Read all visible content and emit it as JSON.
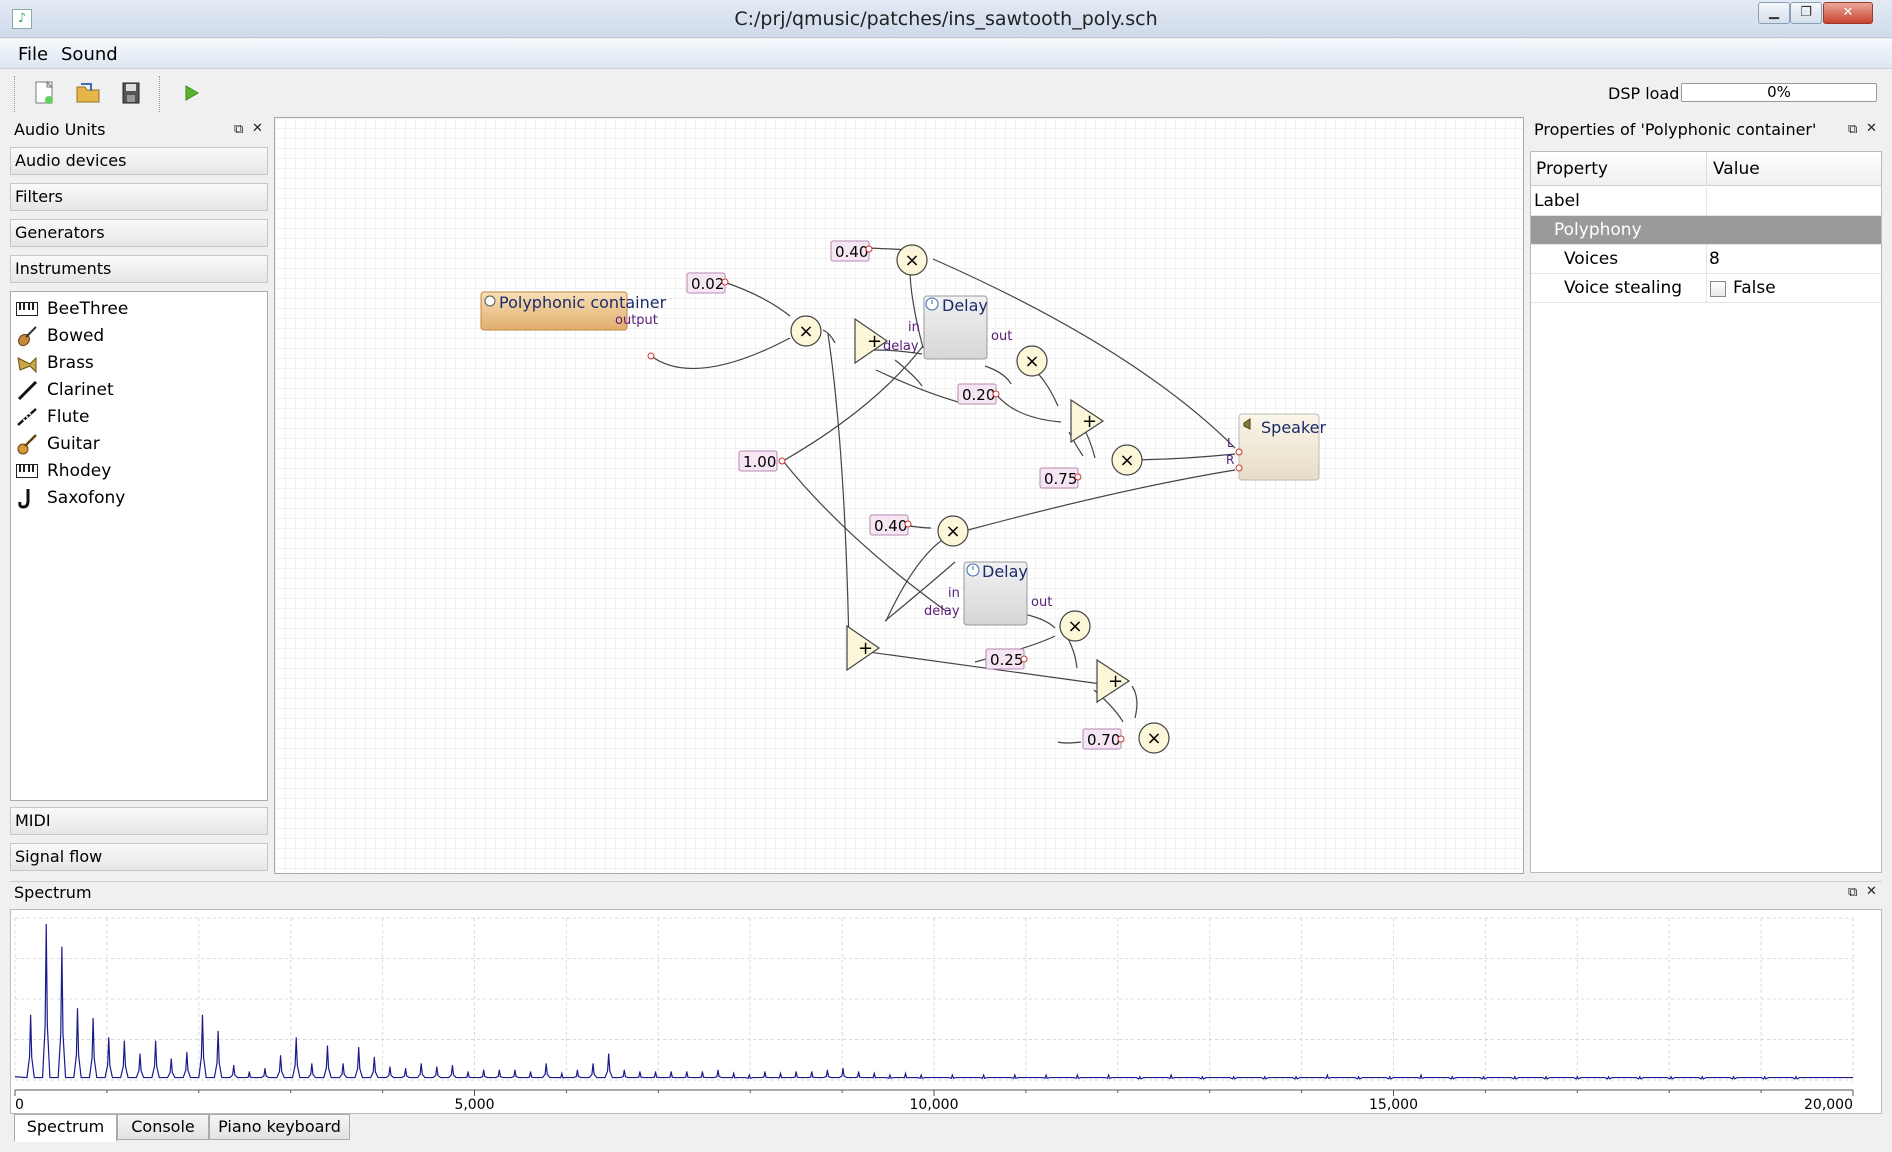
{
  "window": {
    "title": "C:/prj/qmusic/patches/ins_sawtooth_poly.sch"
  },
  "menu": {
    "file": "File",
    "sound": "Sound"
  },
  "toolbar": {
    "dsp_label": "DSP load",
    "dsp_value": "0%",
    "dsp_fraction": 0.0
  },
  "left_panel": {
    "title": "Audio Units",
    "categories_top": [
      "Audio devices",
      "Filters",
      "Generators",
      "Instruments"
    ],
    "instruments": [
      {
        "label": "BeeThree",
        "icon": "keyboard-icon"
      },
      {
        "label": "Bowed",
        "icon": "violin-icon"
      },
      {
        "label": "Brass",
        "icon": "trumpet-icon"
      },
      {
        "label": "Clarinet",
        "icon": "clarinet-icon"
      },
      {
        "label": "Flute",
        "icon": "flute-icon"
      },
      {
        "label": "Guitar",
        "icon": "guitar-icon"
      },
      {
        "label": "Rhodey",
        "icon": "keyboard-icon"
      },
      {
        "label": "Saxofony",
        "icon": "saxophone-icon"
      }
    ],
    "categories_bottom": [
      "MIDI",
      "Signal flow"
    ]
  },
  "canvas": {
    "container_label": "Polyphonic container",
    "container_port": "output",
    "delay_label": "Delay",
    "speaker_label": "Speaker",
    "port_in": "in",
    "port_delay": "delay",
    "port_out": "out",
    "port_l": "L",
    "port_r": "R",
    "constants": [
      "0.40",
      "0.02",
      "1.00",
      "0.20",
      "0.75",
      "0.40",
      "0.25",
      "0.70"
    ],
    "mul_symbol": "×",
    "add_symbol": "+"
  },
  "properties": {
    "title": "Properties of 'Polyphonic container'",
    "col_property": "Property",
    "col_value": "Value",
    "label_row": "Label",
    "group": "Polyphony",
    "voices_label": "Voices",
    "voices_value": "8",
    "stealing_label": "Voice stealing",
    "stealing_value": "False"
  },
  "spectrum": {
    "title": "Spectrum",
    "tabs": [
      "Spectrum",
      "Console",
      "Piano keyboard"
    ]
  },
  "chart_data": {
    "type": "line",
    "xlim": [
      0,
      20000
    ],
    "ylim": [
      0,
      1
    ],
    "x_ticks": [
      "0",
      "5,000",
      "10,000",
      "15,000",
      "20,000"
    ],
    "grid": true,
    "series_color": "#1a1a8c",
    "series": [
      {
        "peaks_x": [
          170,
          340,
          510,
          680,
          850,
          1020,
          1190,
          1360,
          1530,
          1700,
          1870,
          2040,
          2210,
          2380,
          2550,
          2720,
          2890,
          3060,
          3230,
          3400,
          3570,
          3740,
          3910,
          4080,
          4250,
          4420,
          4590,
          4760,
          4930,
          5100,
          5270,
          5440,
          5610,
          5780,
          5950,
          6120,
          6290,
          6460,
          6630,
          6800,
          6970,
          7140,
          7310,
          7480,
          7650,
          7820,
          7990,
          8160,
          8330,
          8500,
          8670,
          8840,
          9010,
          9180,
          9350,
          9520,
          9690,
          9860,
          10200,
          10540,
          10880,
          11220,
          11560,
          11900,
          12240,
          12580,
          12920,
          13260,
          13600,
          13940,
          14280,
          14620,
          14960,
          15300,
          15640,
          15980,
          16320,
          16660,
          17000,
          17340,
          17680,
          18020,
          18360,
          18700,
          19040,
          19380
        ],
        "peaks_y": [
          0.4,
          0.96,
          0.82,
          0.44,
          0.38,
          0.26,
          0.24,
          0.16,
          0.24,
          0.13,
          0.17,
          0.4,
          0.3,
          0.09,
          0.05,
          0.07,
          0.15,
          0.26,
          0.1,
          0.21,
          0.1,
          0.2,
          0.14,
          0.08,
          0.07,
          0.1,
          0.08,
          0.09,
          0.05,
          0.06,
          0.06,
          0.06,
          0.05,
          0.1,
          0.04,
          0.06,
          0.1,
          0.16,
          0.06,
          0.05,
          0.05,
          0.05,
          0.05,
          0.05,
          0.06,
          0.04,
          0.03,
          0.05,
          0.04,
          0.05,
          0.05,
          0.06,
          0.07,
          0.05,
          0.04,
          0.03,
          0.04,
          0.03,
          0.03,
          0.03,
          0.03,
          0.03,
          0.03,
          0.03,
          0.02,
          0.03,
          0.02,
          0.02,
          0.02,
          0.02,
          0.03,
          0.02,
          0.02,
          0.03,
          0.02,
          0.02,
          0.02,
          0.02,
          0.02,
          0.02,
          0.02,
          0.02,
          0.02,
          0.02,
          0.02,
          0.02
        ]
      }
    ]
  }
}
